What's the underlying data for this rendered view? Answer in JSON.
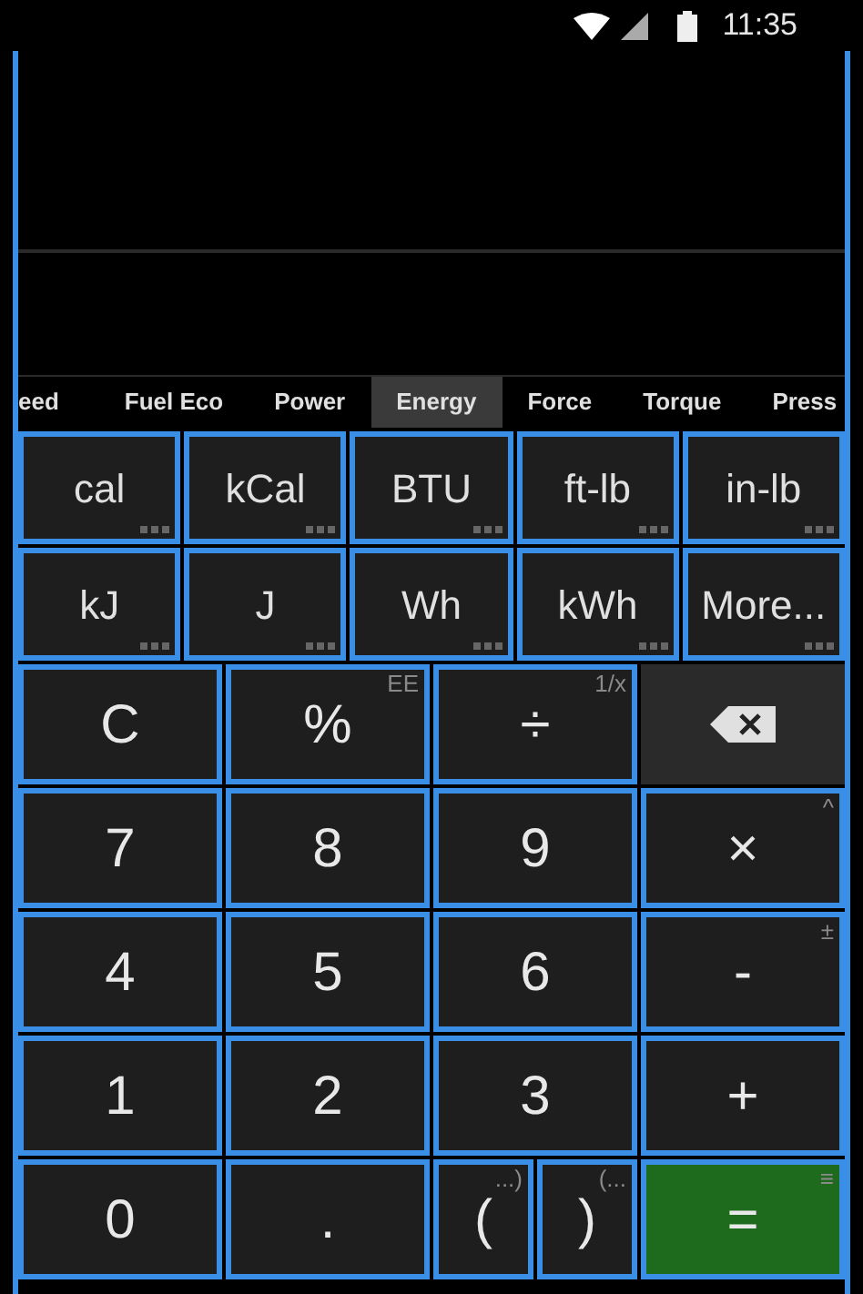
{
  "status_bar": {
    "time": "11:35"
  },
  "tabs": [
    {
      "label": "eed",
      "selected": false
    },
    {
      "label": "Fuel Eco",
      "selected": false
    },
    {
      "label": "Power",
      "selected": false
    },
    {
      "label": "Energy",
      "selected": true
    },
    {
      "label": "Force",
      "selected": false
    },
    {
      "label": "Torque",
      "selected": false
    },
    {
      "label": "Press",
      "selected": false
    }
  ],
  "units": [
    {
      "label": "cal"
    },
    {
      "label": "kCal"
    },
    {
      "label": "BTU"
    },
    {
      "label": "ft-lb"
    },
    {
      "label": "in-lb"
    },
    {
      "label": "kJ"
    },
    {
      "label": "J"
    },
    {
      "label": "Wh"
    },
    {
      "label": "kWh"
    },
    {
      "label": "More..."
    }
  ],
  "keys": [
    {
      "kind": "key",
      "label": "C"
    },
    {
      "kind": "key",
      "label": "%",
      "sub": "EE"
    },
    {
      "kind": "key",
      "label": "÷",
      "sub": "1/x"
    },
    {
      "kind": "backspace"
    },
    {
      "kind": "key",
      "label": "7"
    },
    {
      "kind": "key",
      "label": "8"
    },
    {
      "kind": "key",
      "label": "9"
    },
    {
      "kind": "key",
      "label": "×",
      "sub": "^"
    },
    {
      "kind": "key",
      "label": "4"
    },
    {
      "kind": "key",
      "label": "5"
    },
    {
      "kind": "key",
      "label": "6"
    },
    {
      "kind": "key",
      "label": "-",
      "sub": "±"
    },
    {
      "kind": "key",
      "label": "1"
    },
    {
      "kind": "key",
      "label": "2"
    },
    {
      "kind": "key",
      "label": "3"
    },
    {
      "kind": "key",
      "label": "+"
    },
    {
      "kind": "key",
      "label": "0"
    },
    {
      "kind": "key",
      "label": "."
    },
    {
      "kind": "paren",
      "label": "(",
      "sub": "...)"
    },
    {
      "kind": "paren",
      "label": ")",
      "sub": "(..."
    },
    {
      "kind": "equals",
      "label": "=",
      "sub": "≡"
    }
  ]
}
